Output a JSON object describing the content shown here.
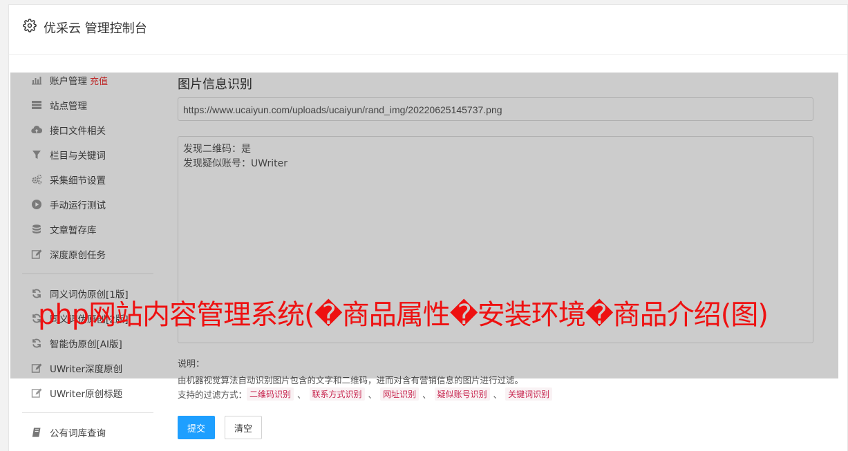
{
  "header": {
    "title": "优采云 管理控制台",
    "icon": "gear-icon"
  },
  "sidebar": {
    "items": [
      {
        "label": "账户管理",
        "badge": "充值",
        "icon": "bar-chart-icon"
      },
      {
        "label": "站点管理",
        "icon": "server-icon"
      },
      {
        "label": "接口文件相关",
        "icon": "cloud-upload-icon"
      },
      {
        "label": "栏目与关键词",
        "icon": "filter-icon"
      },
      {
        "label": "采集细节设置",
        "icon": "cogs-icon"
      },
      {
        "label": "手动运行测试",
        "icon": "play-circle-icon"
      },
      {
        "label": "文章暂存库",
        "icon": "database-icon"
      },
      {
        "label": "深度原创任务",
        "icon": "edit-icon"
      },
      {
        "label": "同义词伪原创[1版]",
        "icon": "refresh-icon"
      },
      {
        "label": "同义词伪原创[2版]",
        "icon": "refresh-icon"
      },
      {
        "label": "智能伪原创[AI版]",
        "icon": "refresh-icon"
      },
      {
        "label": "UWriter深度原创",
        "icon": "edit-icon"
      },
      {
        "label": "UWriter原创标题",
        "icon": "edit-icon"
      },
      {
        "label": "公有词库查询",
        "icon": "book-icon"
      }
    ]
  },
  "main": {
    "section_title": "图片信息识别",
    "url_value": "https://www.ucaiyun.com/uploads/ucaiyun/rand_img/20220625145737.png",
    "result_lines": [
      "发现二维码：是",
      "发现疑似账号：UWriter"
    ],
    "note_label": "说明：",
    "note_text": "由机器视觉算法自动识别图片包含的文字和二维码，进而对含有营销信息的图片进行过滤。",
    "filter_label": "支持的过滤方式：",
    "filter_tags": [
      "二维码识别",
      "联系方式识别",
      "网址识别",
      "疑似账号识别",
      "关键词识别"
    ],
    "filter_separator": "、",
    "submit_label": "提交",
    "clear_label": "清空"
  },
  "watermark": "php网站内容管理系统(�商品属性�安装环境�商品介绍(图)",
  "colors": {
    "primary": "#1e9fff",
    "badge": "#ee3333",
    "tag_text": "#c7254e",
    "tag_bg": "#f9f2f4",
    "watermark": "#ee1111"
  }
}
